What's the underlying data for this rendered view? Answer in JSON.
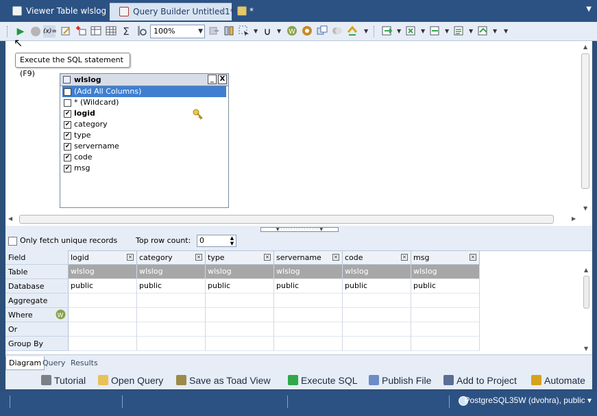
{
  "tabs": [
    {
      "label": "Viewer Table wlslog",
      "icon": "table-viewer-icon"
    },
    {
      "label": "Query Builder Untitled1*",
      "icon": "query-builder-icon",
      "close": "✕"
    },
    {
      "label": "*",
      "icon": "sql-editor-icon"
    }
  ],
  "toolbar": {
    "zoom_value": "100%",
    "tooltip": "Execute the SQL statement (F9)"
  },
  "table_box": {
    "title": "wlslog",
    "minimize": "_",
    "close": "X",
    "rows": [
      {
        "label": "(Add All Columns)",
        "checked": true,
        "selected": true,
        "bold": false
      },
      {
        "label": "* (Wildcard)",
        "checked": false,
        "selected": false,
        "bold": false
      },
      {
        "label": "logid",
        "checked": true,
        "selected": false,
        "bold": true
      },
      {
        "label": "category",
        "checked": true,
        "selected": false,
        "bold": false
      },
      {
        "label": "type",
        "checked": true,
        "selected": false,
        "bold": false
      },
      {
        "label": "servername",
        "checked": true,
        "selected": false,
        "bold": false
      },
      {
        "label": "code",
        "checked": true,
        "selected": false,
        "bold": false
      },
      {
        "label": "msg",
        "checked": true,
        "selected": false,
        "bold": false
      }
    ]
  },
  "options": {
    "unique_label": "Only fetch unique records",
    "top_row_label": "Top row count:",
    "top_row_value": "0"
  },
  "grid": {
    "row_labels": [
      "Field",
      "Table",
      "Database",
      "Aggregate",
      "Where",
      "Or",
      "Group By"
    ],
    "columns": [
      {
        "field": "logid",
        "table": "wlslog",
        "database": "public"
      },
      {
        "field": "category",
        "table": "wlslog",
        "database": "public"
      },
      {
        "field": "type",
        "table": "wlslog",
        "database": "public"
      },
      {
        "field": "servername",
        "table": "wlslog",
        "database": "public"
      },
      {
        "field": "code",
        "table": "wlslog",
        "database": "public"
      },
      {
        "field": "msg",
        "table": "wlslog",
        "database": "public"
      }
    ]
  },
  "bottom_tabs": [
    "Diagram",
    "Query",
    "Results"
  ],
  "actions": [
    {
      "label": "Tutorial",
      "icon": "tutorial-icon",
      "color": "#7a7f88"
    },
    {
      "label": "Open Query",
      "icon": "folder-icon",
      "color": "#e9c15a"
    },
    {
      "label": "Save as Toad View",
      "icon": "toad-view-icon",
      "color": "#9b8a4a"
    },
    {
      "label": "Execute SQL",
      "icon": "play-icon",
      "color": "#2fa84a"
    },
    {
      "label": "Publish File",
      "icon": "publish-icon",
      "color": "#6b8cc7"
    },
    {
      "label": "Add to Project",
      "icon": "project-icon",
      "color": "#5a6e96"
    },
    {
      "label": "Automate",
      "icon": "automate-icon",
      "color": "#d6a21c"
    }
  ],
  "status": {
    "connection": "PostgreSQL35W (dvohra), public"
  }
}
